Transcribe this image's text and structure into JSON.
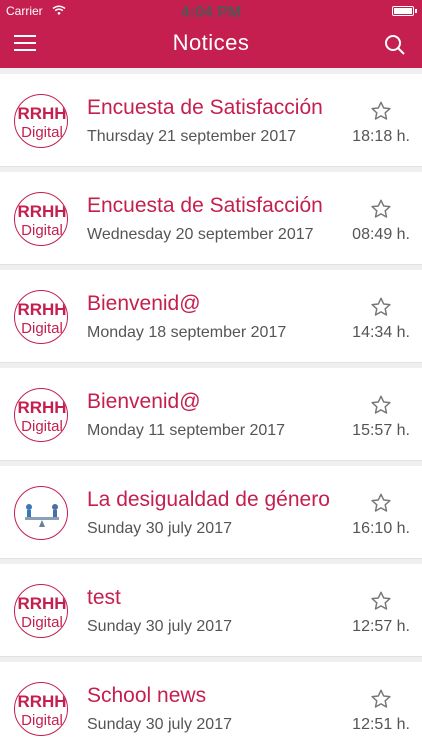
{
  "status_bar": {
    "carrier": "Carrier",
    "time": "4:04 PM"
  },
  "nav": {
    "title": "Notices"
  },
  "notices": [
    {
      "title": "Encuesta de Satisfacción",
      "date": "Thursday 21 september 2017",
      "time": "18:18 h.",
      "avatar": "rrhh-digital-logo"
    },
    {
      "title": "Encuesta de Satisfacción",
      "date": "Wednesday 20 september 2017",
      "time": "08:49 h.",
      "avatar": "rrhh-digital-logo"
    },
    {
      "title": "Bienvenid@",
      "date": "Monday 18 september 2017",
      "time": "14:34 h.",
      "avatar": "rrhh-digital-logo"
    },
    {
      "title": "Bienvenid@",
      "date": "Monday 11 september 2017",
      "time": "15:57 h.",
      "avatar": "rrhh-digital-logo"
    },
    {
      "title": "La desigualdad de género",
      "date": "Sunday 30 july 2017",
      "time": "16:10 h.",
      "avatar": "balance-scale-image"
    },
    {
      "title": "test",
      "date": "Sunday 30 july 2017",
      "time": "12:57 h.",
      "avatar": "rrhh-digital-logo"
    },
    {
      "title": "School news",
      "date": "Sunday 30 july 2017",
      "time": "12:51 h.",
      "avatar": "rrhh-digital-logo"
    }
  ],
  "colors": {
    "brand": "#c41f4f",
    "background": "#efefef",
    "text_muted": "#555555"
  },
  "logo_text": {
    "top": "RRHH",
    "bottom": "Digital"
  }
}
